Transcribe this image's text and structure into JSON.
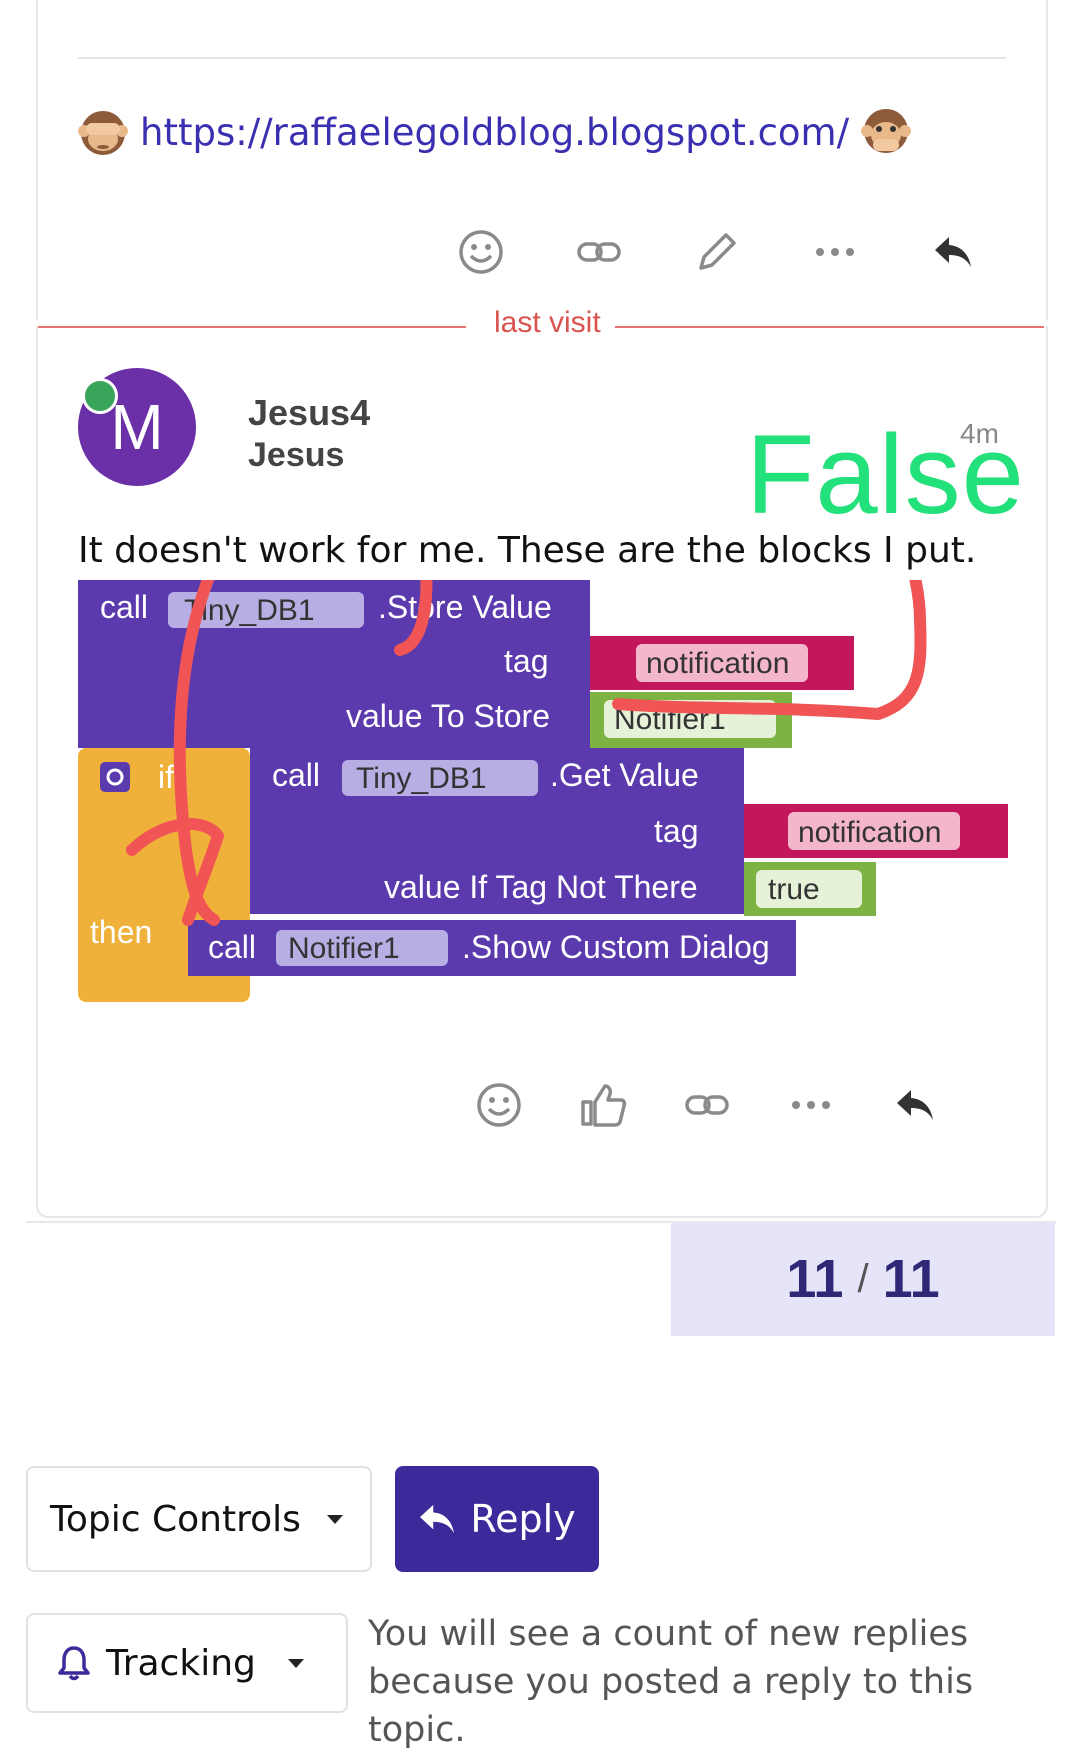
{
  "previous_post": {
    "link_text": "https://raffaelegoldblog.blogspot.com/",
    "emoji_left": "see-no-evil-monkey",
    "emoji_right": "speak-no-evil-monkey",
    "actions": [
      "smile-icon",
      "link-icon",
      "pencil-icon",
      "more-icon",
      "reply-icon"
    ]
  },
  "divider": {
    "label": "last visit"
  },
  "post": {
    "avatar_letter": "M",
    "username": "Jesus4",
    "fullname": "Jesus",
    "age": "4m",
    "annotation": "False",
    "text": "It doesn't work for me. These are the blocks I put.",
    "actions": [
      "smile-icon",
      "like-icon",
      "link-icon",
      "more-icon",
      "reply-icon"
    ]
  },
  "blocks": {
    "call": "call",
    "store_component": "Tiny_DB1",
    "store_method": ".Store Value",
    "tag_label": "tag",
    "tag_value": "notification",
    "value_to_store_label": "value To Store",
    "value_to_store": "Notifier1",
    "if_label": "if",
    "get_component": "Tiny_DB1",
    "get_method": ".Get Value",
    "value_if_not_there_label": "value If Tag Not There",
    "true_value": "true",
    "then_label": "then",
    "dialog_component": "Notifier1",
    "dialog_method": ".Show Custom Dialog"
  },
  "progress": {
    "current": "11",
    "separator": "/",
    "total": "11"
  },
  "footer": {
    "topic_controls": "Topic Controls",
    "reply": "Reply",
    "tracking": "Tracking",
    "tracking_desc": "You will see a count of new replies because you posted a reply to this topic."
  },
  "colors": {
    "accent": "#3d2a9a",
    "block_purple": "#5b3aae",
    "block_text_pink": "#c2185b",
    "block_green": "#7cb342",
    "block_yellow": "#f0b13a",
    "annotation_green": "#22e07a",
    "scribble_red": "#f05454"
  }
}
